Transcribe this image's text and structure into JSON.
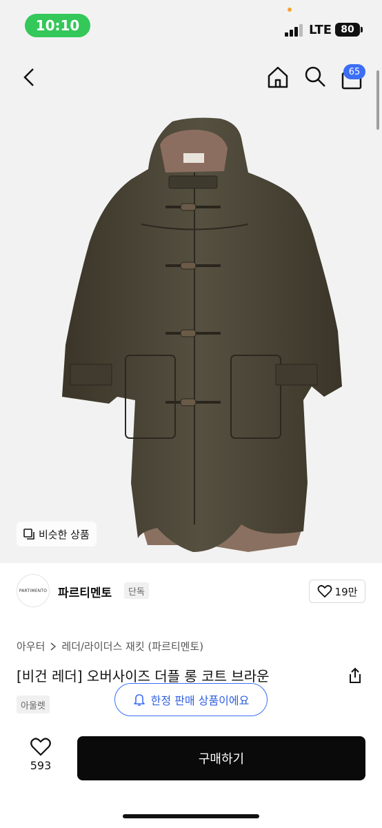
{
  "status": {
    "time": "10:10",
    "network": "LTE",
    "battery": "80"
  },
  "nav": {
    "back_icon": "chevron-left-icon",
    "home_icon": "home-icon",
    "search_icon": "search-icon",
    "cart_icon": "shopping-bag-icon",
    "cart_count": "65"
  },
  "hero": {
    "similar_label": "비슷한 상품",
    "coat_color": "#4a4536"
  },
  "brand": {
    "logo_text": "PARTIMENTO",
    "name": "파르티멘토",
    "tag": "단독",
    "likes": "19만"
  },
  "product": {
    "breadcrumb": [
      "아우터",
      "레더/라이더스 재킷 (파르티멘토)"
    ],
    "title": "[비건 레더] 오버사이즈 더플 롱 코트 브라운",
    "outlet_tag": "아울렛",
    "limited_notice": "한정 판매 상품이에요"
  },
  "bottom": {
    "wish_count": "593",
    "buy_label": "구매하기"
  },
  "colors": {
    "accent": "#3b6ef5",
    "buy_bg": "#0a0a0a",
    "status_green": "#34c759"
  }
}
